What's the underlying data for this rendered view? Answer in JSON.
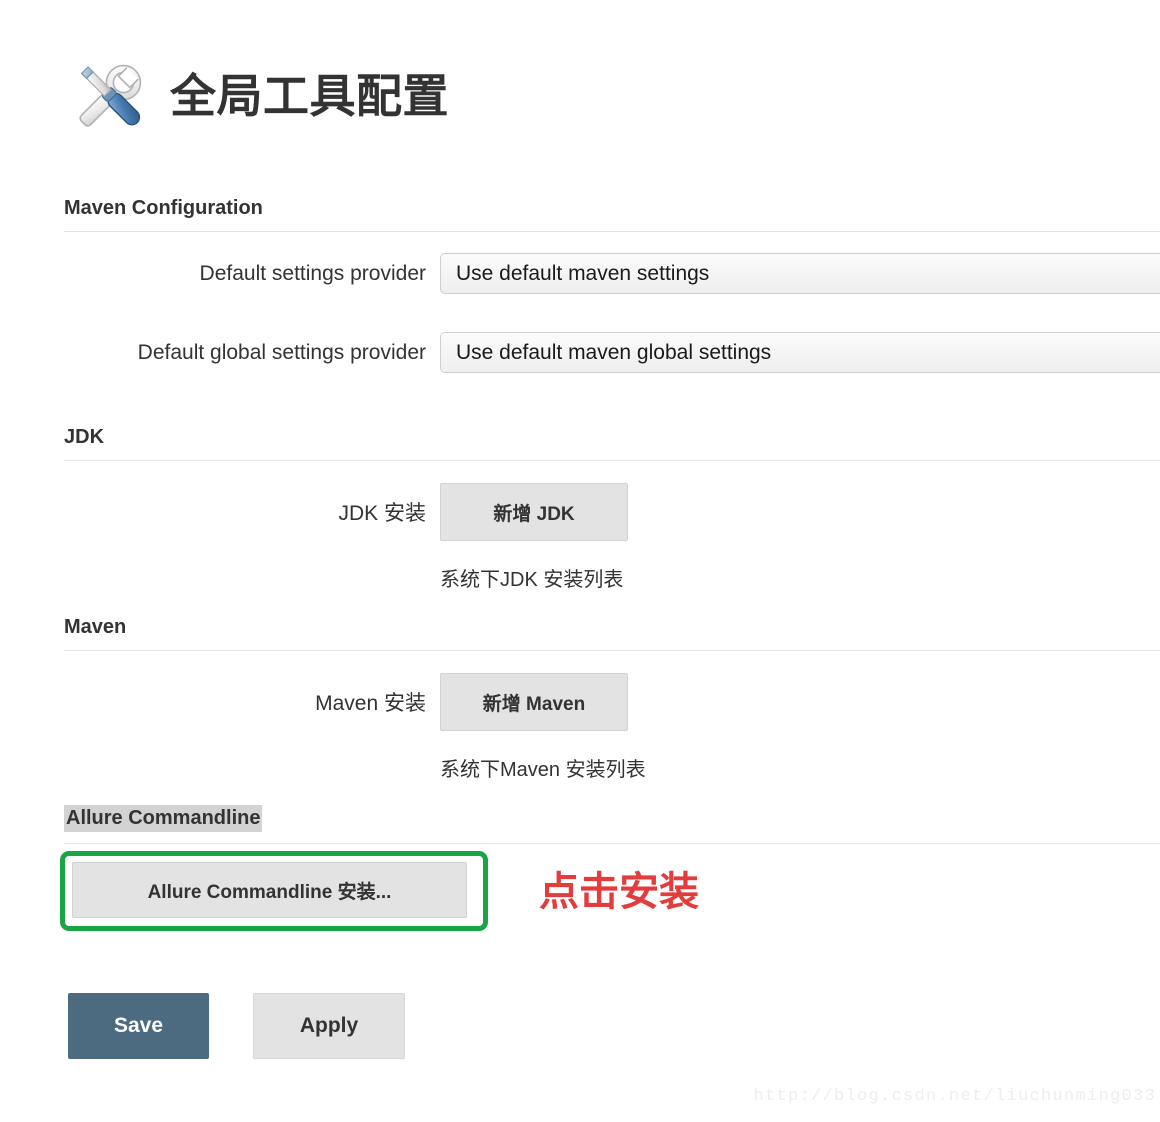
{
  "header": {
    "title": "全局工具配置",
    "icon": "tools-wrench-screwdriver-icon"
  },
  "sections": [
    {
      "heading": "Maven Configuration",
      "rows": [
        {
          "label": "Default settings provider",
          "value": "Use default maven settings"
        },
        {
          "label": "Default global settings provider",
          "value": "Use default maven global settings"
        }
      ]
    },
    {
      "heading": "JDK",
      "row_label": "JDK 安装",
      "button": "新增 JDK",
      "help": "系统下JDK 安装列表"
    },
    {
      "heading": "Maven",
      "row_label": "Maven 安装",
      "button": "新增 Maven",
      "help": "系统下Maven 安装列表"
    },
    {
      "heading": "Allure Commandline",
      "button": "Allure Commandline 安装..."
    }
  ],
  "annotation": {
    "text": "点击安装",
    "box_color": "#1aa544",
    "text_color": "#e33c3c"
  },
  "actions": {
    "save_label": "Save",
    "apply_label": "Apply",
    "save_color": "#4c6a80"
  },
  "watermark": "http://blog.csdn.net/liuchunming033"
}
